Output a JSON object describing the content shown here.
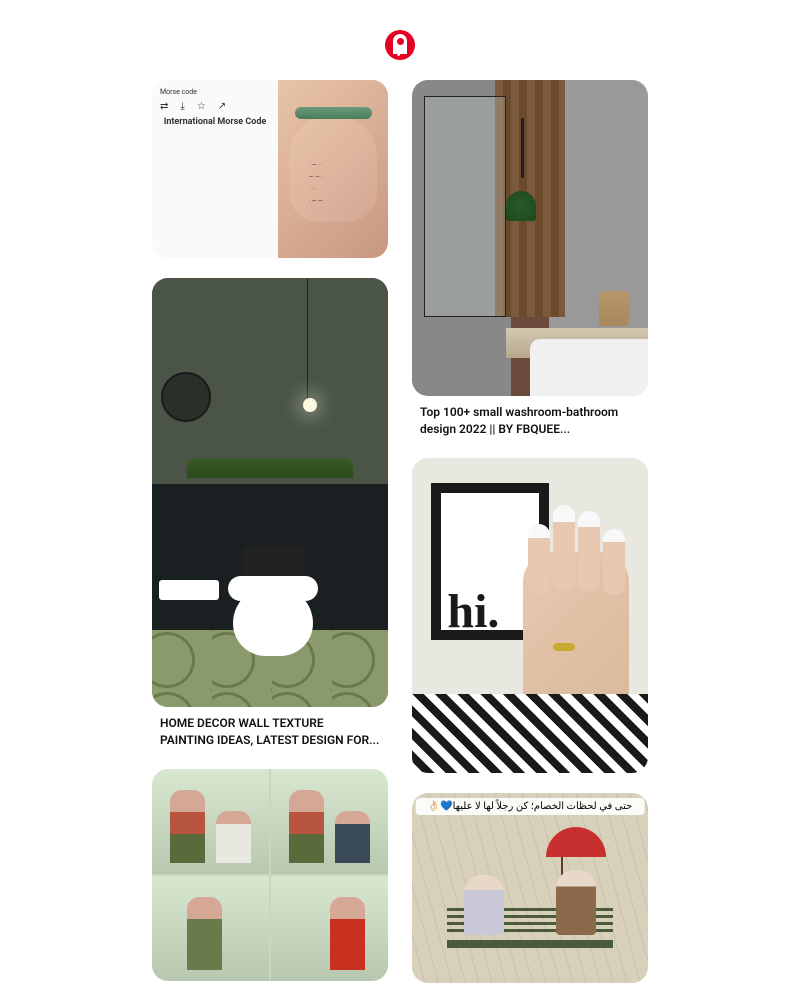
{
  "brand": {
    "name": "Pinterest",
    "accent_color": "#e60023"
  },
  "pins": {
    "morse": {
      "header": "Morse code",
      "chart_title": "International Morse Code",
      "title": ""
    },
    "dark_bathroom": {
      "title": "HOME DECOR WALL TEXTURE PAINTING IDEAS, LATEST DESIGN FOR..."
    },
    "comic": {
      "title": ""
    },
    "modern_bathroom": {
      "title": "Top 100+ small washroom-bathroom design 2022 || BY FBQUEE..."
    },
    "nails": {
      "frame_text": "hi.",
      "title": ""
    },
    "couple": {
      "caption": "حتى في لحظات الخصام؛ كن رجلاً لها لا عليها💙👌🏻",
      "title": ""
    }
  }
}
